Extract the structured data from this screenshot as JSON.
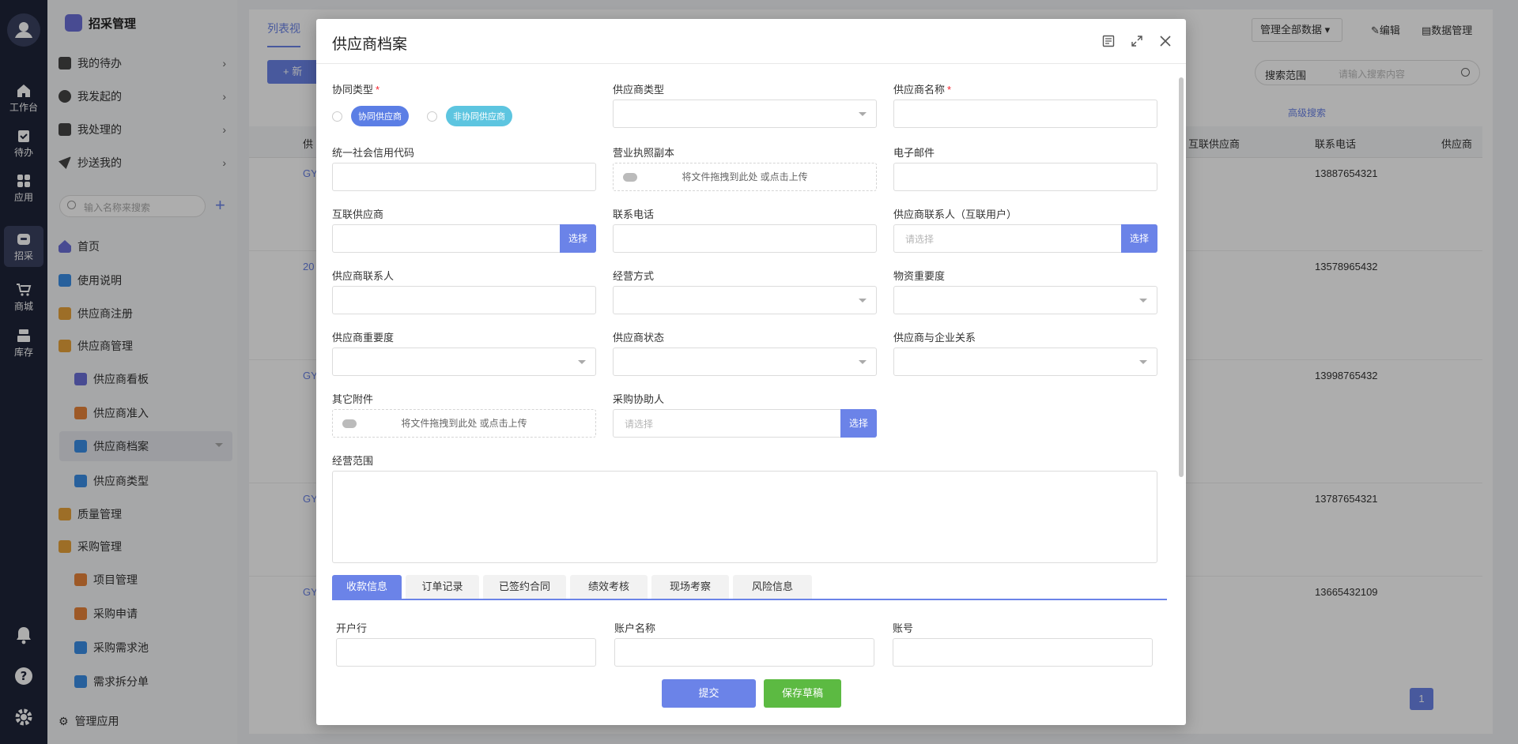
{
  "rail": {
    "items": [
      {
        "label": "工作台"
      },
      {
        "label": "待办"
      },
      {
        "label": "应用"
      },
      {
        "label": "招采"
      },
      {
        "label": "商城"
      },
      {
        "label": "库存"
      }
    ]
  },
  "nav": {
    "app_title": "招采管理",
    "quick": [
      {
        "label": "我的待办"
      },
      {
        "label": "我发起的"
      },
      {
        "label": "我处理的"
      },
      {
        "label": "抄送我的"
      }
    ],
    "search_placeholder": "输入名称来搜索",
    "add_icon": "+",
    "items": [
      {
        "label": "首页"
      },
      {
        "label": "使用说明"
      },
      {
        "label": "供应商注册"
      },
      {
        "label": "供应商管理"
      },
      {
        "label": "供应商看板"
      },
      {
        "label": "供应商准入"
      },
      {
        "label": "供应商档案"
      },
      {
        "label": "供应商类型"
      },
      {
        "label": "质量管理"
      },
      {
        "label": "采购管理"
      },
      {
        "label": "项目管理"
      },
      {
        "label": "采购申请"
      },
      {
        "label": "采购需求池"
      },
      {
        "label": "需求拆分单"
      }
    ],
    "manage_app": "管理应用"
  },
  "background": {
    "view_tab": "列表视",
    "new_btn": "+ 新",
    "manage_all": "管理全部数据",
    "edit": "编辑",
    "data_manage": "数据管理",
    "search_scope": "搜索范围",
    "search_placeholder": "请输入搜索内容",
    "advanced_search": "高级搜索",
    "columns": [
      "供",
      "互联供应商",
      "联系电话",
      "供应商"
    ],
    "rows": [
      {
        "code": "GY",
        "phone": "13887654321"
      },
      {
        "code": "20",
        "phone": "13578965432"
      },
      {
        "code": "GY",
        "phone": "13998765432"
      },
      {
        "code": "GY",
        "phone": "13787654321"
      },
      {
        "code": "GY",
        "phone": "13665432109"
      }
    ],
    "page": "1"
  },
  "modal": {
    "title": "供应商档案",
    "fields": {
      "coop_type": "协同类型",
      "coop_opt1": "协同供应商",
      "coop_opt2": "非协同供应商",
      "supplier_type": "供应商类型",
      "supplier_name": "供应商名称",
      "credit_code": "统一社会信用代码",
      "license": "营业执照副本",
      "upload_hint": "将文件拖拽到此处 或点击上传",
      "email": "电子邮件",
      "linked_supplier": "互联供应商",
      "phone": "联系电话",
      "linked_contact": "供应商联系人（互联用户）",
      "select_placeholder": "请选择",
      "select_btn": "选择",
      "contact": "供应商联系人",
      "biz_mode": "经营方式",
      "material_importance": "物资重要度",
      "supplier_importance": "供应商重要度",
      "supplier_status": "供应商状态",
      "relation": "供应商与企业关系",
      "attachments": "其它附件",
      "assistant": "采购协助人",
      "scope": "经营范围"
    },
    "tabs": [
      {
        "label": "收款信息"
      },
      {
        "label": "订单记录"
      },
      {
        "label": "已签约合同"
      },
      {
        "label": "绩效考核"
      },
      {
        "label": "现场考察"
      },
      {
        "label": "风险信息"
      }
    ],
    "bank": {
      "bank": "开户行",
      "account_name": "账户名称",
      "account_no": "账号"
    },
    "submit": "提交",
    "save_draft": "保存草稿"
  }
}
